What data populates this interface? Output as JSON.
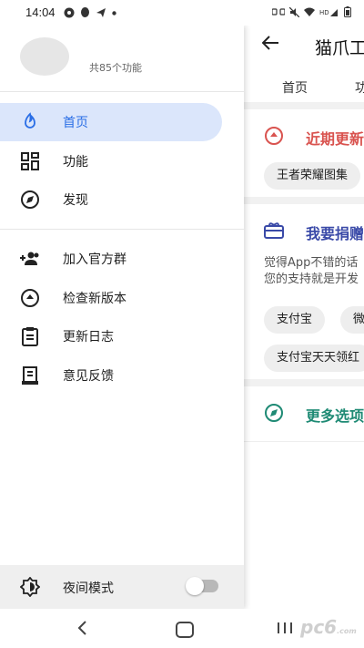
{
  "status_bar": {
    "time": "14:04"
  },
  "background_app": {
    "title": "猫爪工",
    "tabs": [
      "首页",
      "功"
    ],
    "sections": [
      {
        "title": "近期更新",
        "title_color": "#d9534f",
        "chips": [
          "王者荣耀图集"
        ]
      },
      {
        "title": "我要捐赠",
        "title_color": "#3a4aa8",
        "text_lines": [
          "觉得App不错的话",
          "您的支持就是开发"
        ],
        "chips": [
          "支付宝",
          "微",
          "支付宝天天领红"
        ]
      },
      {
        "title": "更多选项",
        "title_color": "#1e8a74"
      }
    ]
  },
  "drawer": {
    "feature_count": "共85个功能",
    "nav_items": [
      {
        "label": "首页",
        "icon": "flame-icon",
        "active": true
      },
      {
        "label": "功能",
        "icon": "grid-icon"
      },
      {
        "label": "发现",
        "icon": "compass-icon"
      }
    ],
    "secondary_items": [
      {
        "label": "加入官方群",
        "icon": "group-add-icon"
      },
      {
        "label": "检查新版本",
        "icon": "upload-circle-icon"
      },
      {
        "label": "更新日志",
        "icon": "clipboard-icon"
      },
      {
        "label": "意见反馈",
        "icon": "feedback-icon"
      }
    ],
    "night_mode": {
      "label": "夜间模式",
      "on": false
    }
  },
  "watermark": {
    "text": "pc6",
    "sub": ".com"
  },
  "colors": {
    "accent": "#2a6ee6",
    "active_bg": "#dbe6fb"
  }
}
